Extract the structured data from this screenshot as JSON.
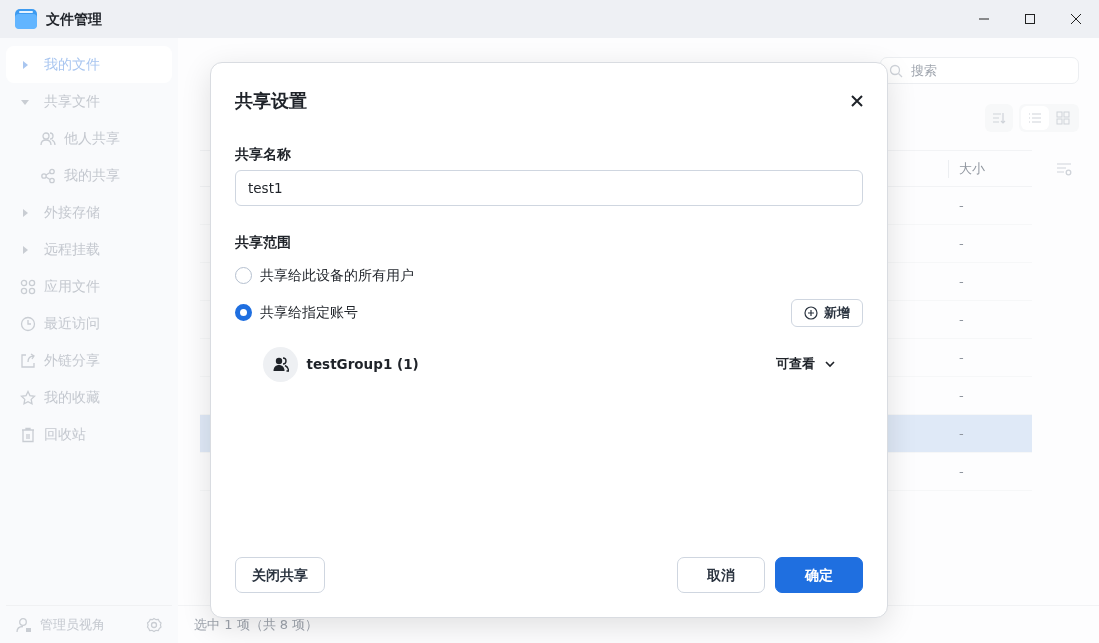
{
  "window": {
    "title": "文件管理"
  },
  "sidebar": {
    "items": [
      {
        "label": "我的文件",
        "kind": "tree",
        "selected": true,
        "expanded": false
      },
      {
        "label": "共享文件",
        "kind": "tree",
        "selected": false,
        "expanded": true,
        "children": [
          {
            "label": "他人共享",
            "kind": "people",
            "selected": false
          },
          {
            "label": "我的共享",
            "kind": "share",
            "selected": false
          }
        ]
      },
      {
        "label": "外接存储",
        "kind": "tree",
        "selected": false,
        "expanded": false
      },
      {
        "label": "远程挂载",
        "kind": "tree",
        "selected": false,
        "expanded": false
      },
      {
        "label": "应用文件",
        "kind": "apps",
        "selected": false
      },
      {
        "label": "最近访问",
        "kind": "clock",
        "selected": false
      },
      {
        "label": "外链分享",
        "kind": "export",
        "selected": false
      },
      {
        "label": "我的收藏",
        "kind": "star",
        "selected": false
      },
      {
        "label": "回收站",
        "kind": "trash",
        "selected": false
      }
    ],
    "footer": {
      "label": "管理员视角"
    }
  },
  "search": {
    "placeholder": "搜索"
  },
  "table": {
    "columns": [
      "大小"
    ],
    "rows": [
      {
        "size": "-",
        "selected": false
      },
      {
        "size": "-",
        "selected": false
      },
      {
        "size": "-",
        "selected": false
      },
      {
        "size": "-",
        "selected": false
      },
      {
        "size": "-",
        "selected": false
      },
      {
        "size": "-",
        "selected": false
      },
      {
        "size": "-",
        "selected": true
      },
      {
        "size": "-",
        "selected": false
      }
    ]
  },
  "status_bar": "选中 1 项（共 8 项）",
  "dialog": {
    "title": "共享设置",
    "name_label": "共享名称",
    "name_value": "test1",
    "scope_label": "共享范围",
    "scope_options": [
      {
        "label": "共享给此设备的所有用户",
        "selected": false
      },
      {
        "label": "共享给指定账号",
        "selected": true
      }
    ],
    "add_button": "新增",
    "members": [
      {
        "name": "testGroup1 (1)",
        "permission": "可查看"
      }
    ],
    "buttons": [
      {
        "label": "关闭共享",
        "kind": "outline"
      },
      {
        "label": "取消",
        "kind": "outline"
      },
      {
        "label": "确定",
        "kind": "primary"
      }
    ]
  }
}
